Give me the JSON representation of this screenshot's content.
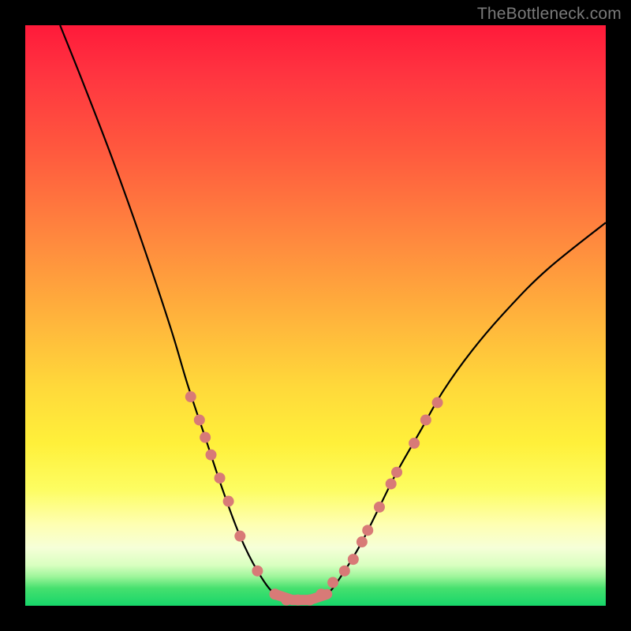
{
  "watermark": "TheBottleneck.com",
  "colors": {
    "frame": "#000000",
    "curve": "#000000",
    "dot": "#d87a77",
    "gradient_top": "#ff1a3a",
    "gradient_bottom": "#17d66a"
  },
  "chart_data": {
    "type": "line",
    "title": "",
    "xlabel": "",
    "ylabel": "",
    "xlim": [
      0,
      100
    ],
    "ylim": [
      0,
      100
    ],
    "curve": [
      {
        "x": 6,
        "y": 100
      },
      {
        "x": 10,
        "y": 90
      },
      {
        "x": 15,
        "y": 77
      },
      {
        "x": 20,
        "y": 63
      },
      {
        "x": 25,
        "y": 48
      },
      {
        "x": 28,
        "y": 38
      },
      {
        "x": 31,
        "y": 29
      },
      {
        "x": 34,
        "y": 20
      },
      {
        "x": 37,
        "y": 12
      },
      {
        "x": 40,
        "y": 6
      },
      {
        "x": 43,
        "y": 2
      },
      {
        "x": 46,
        "y": 1
      },
      {
        "x": 49,
        "y": 1
      },
      {
        "x": 52,
        "y": 2
      },
      {
        "x": 55,
        "y": 6
      },
      {
        "x": 58,
        "y": 11
      },
      {
        "x": 61,
        "y": 17
      },
      {
        "x": 64,
        "y": 23
      },
      {
        "x": 68,
        "y": 30
      },
      {
        "x": 72,
        "y": 37
      },
      {
        "x": 77,
        "y": 44
      },
      {
        "x": 83,
        "y": 51
      },
      {
        "x": 90,
        "y": 58
      },
      {
        "x": 100,
        "y": 66
      }
    ],
    "dots": [
      {
        "x": 28.5,
        "y": 36
      },
      {
        "x": 30,
        "y": 32
      },
      {
        "x": 31,
        "y": 29
      },
      {
        "x": 32,
        "y": 26
      },
      {
        "x": 33.5,
        "y": 22
      },
      {
        "x": 35,
        "y": 18
      },
      {
        "x": 37,
        "y": 12
      },
      {
        "x": 40,
        "y": 6
      },
      {
        "x": 43,
        "y": 2
      },
      {
        "x": 45,
        "y": 1
      },
      {
        "x": 47,
        "y": 1
      },
      {
        "x": 49,
        "y": 1
      },
      {
        "x": 51,
        "y": 2
      },
      {
        "x": 53,
        "y": 4
      },
      {
        "x": 55,
        "y": 6
      },
      {
        "x": 56.5,
        "y": 8
      },
      {
        "x": 58,
        "y": 11
      },
      {
        "x": 59,
        "y": 13
      },
      {
        "x": 61,
        "y": 17
      },
      {
        "x": 63,
        "y": 21
      },
      {
        "x": 64,
        "y": 23
      },
      {
        "x": 67,
        "y": 28
      },
      {
        "x": 69,
        "y": 32
      },
      {
        "x": 71,
        "y": 35
      }
    ]
  }
}
